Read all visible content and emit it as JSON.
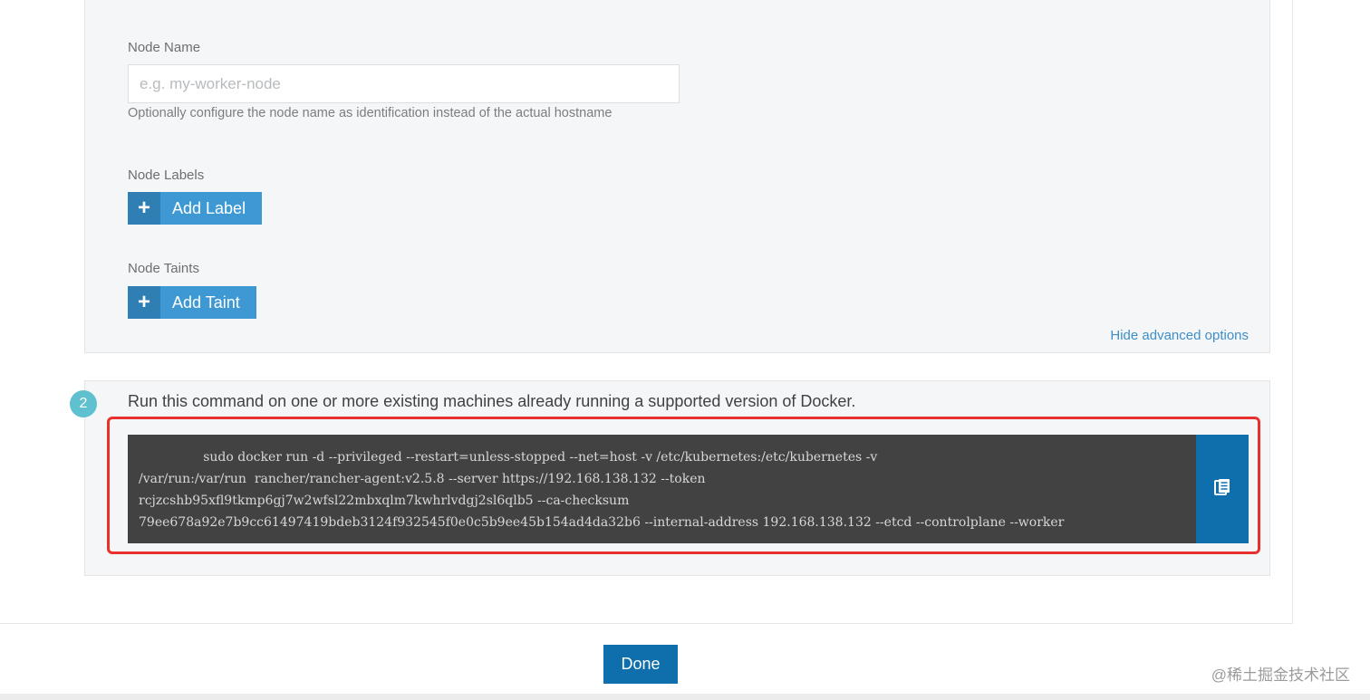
{
  "advanced": {
    "node_name_label": "Node Name",
    "node_name_placeholder": "e.g. my-worker-node",
    "node_name_value": "",
    "node_name_help": "Optionally configure the node name as identification instead of the actual hostname",
    "node_labels_label": "Node Labels",
    "add_label_button": "Add Label",
    "node_taints_label": "Node Taints",
    "add_taint_button": "Add Taint",
    "hide_advanced_link": "Hide advanced options"
  },
  "command_section": {
    "step_number": "2",
    "instruction": "Run this command on one or more existing machines already running a supported version of Docker.",
    "command_lines": [
      "                sudo docker run -d --privileged --restart=unless-stopped --net=host -v /etc/kubernetes:/etc/kubernetes -v",
      "/var/run:/var/run  rancher/rancher-agent:v2.5.8 --server https://192.168.138.132 --token",
      "rcjzcshb95xfl9tkmp6gj7w2wfsl22mbxqlm7kwhrlvdgj2sl6qlb5 --ca-checksum",
      "79ee678a92e7b9cc61497419bdeb3124f932545f0e0c5b9ee45b154ad4da32b6 --internal-address 192.168.138.132 --etcd --controlplane --worker"
    ],
    "copy_icon": "clipboard-icon"
  },
  "footer": {
    "done_button": "Done"
  },
  "watermark": "@稀土掘金技术社区",
  "colors": {
    "primary": "#0f6fad",
    "add_button": "#3d98d3",
    "highlight": "#e8312c",
    "step_badge": "#5fc0cf"
  }
}
